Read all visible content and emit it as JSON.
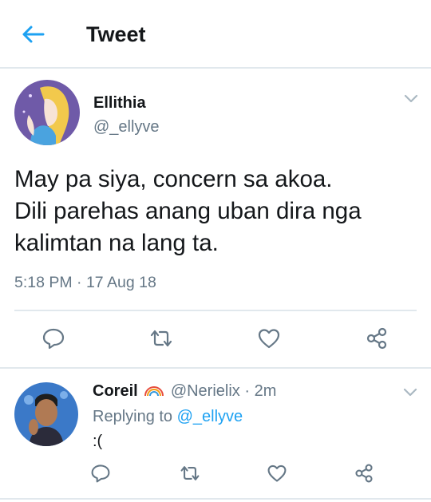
{
  "header": {
    "title": "Tweet"
  },
  "main_tweet": {
    "display_name": "Ellithia",
    "handle": "@_ellyve",
    "text": "May pa siya, concern sa akoa.\nDili parehas anang uban dira nga\nkalimtan na lang ta.",
    "timestamp": "5:18 PM · 17 Aug 18"
  },
  "reply": {
    "display_name": "Coreil",
    "handle": "@Nerielix",
    "time": "· 2m",
    "replying_prefix": "Replying to",
    "replying_to": "@_ellyve",
    "text": ":("
  },
  "icons": {
    "back": "arrow-left-icon",
    "menu": "chevron-down-icon",
    "reply": "comment-icon",
    "retweet": "retweet-icon",
    "like": "heart-icon",
    "share": "share-icon",
    "emoji": "rainbow-emoji"
  },
  "colors": {
    "accent": "#1da1f2",
    "icon_gray": "#657786",
    "divider": "#e1e8ed",
    "text": "#14171a"
  }
}
